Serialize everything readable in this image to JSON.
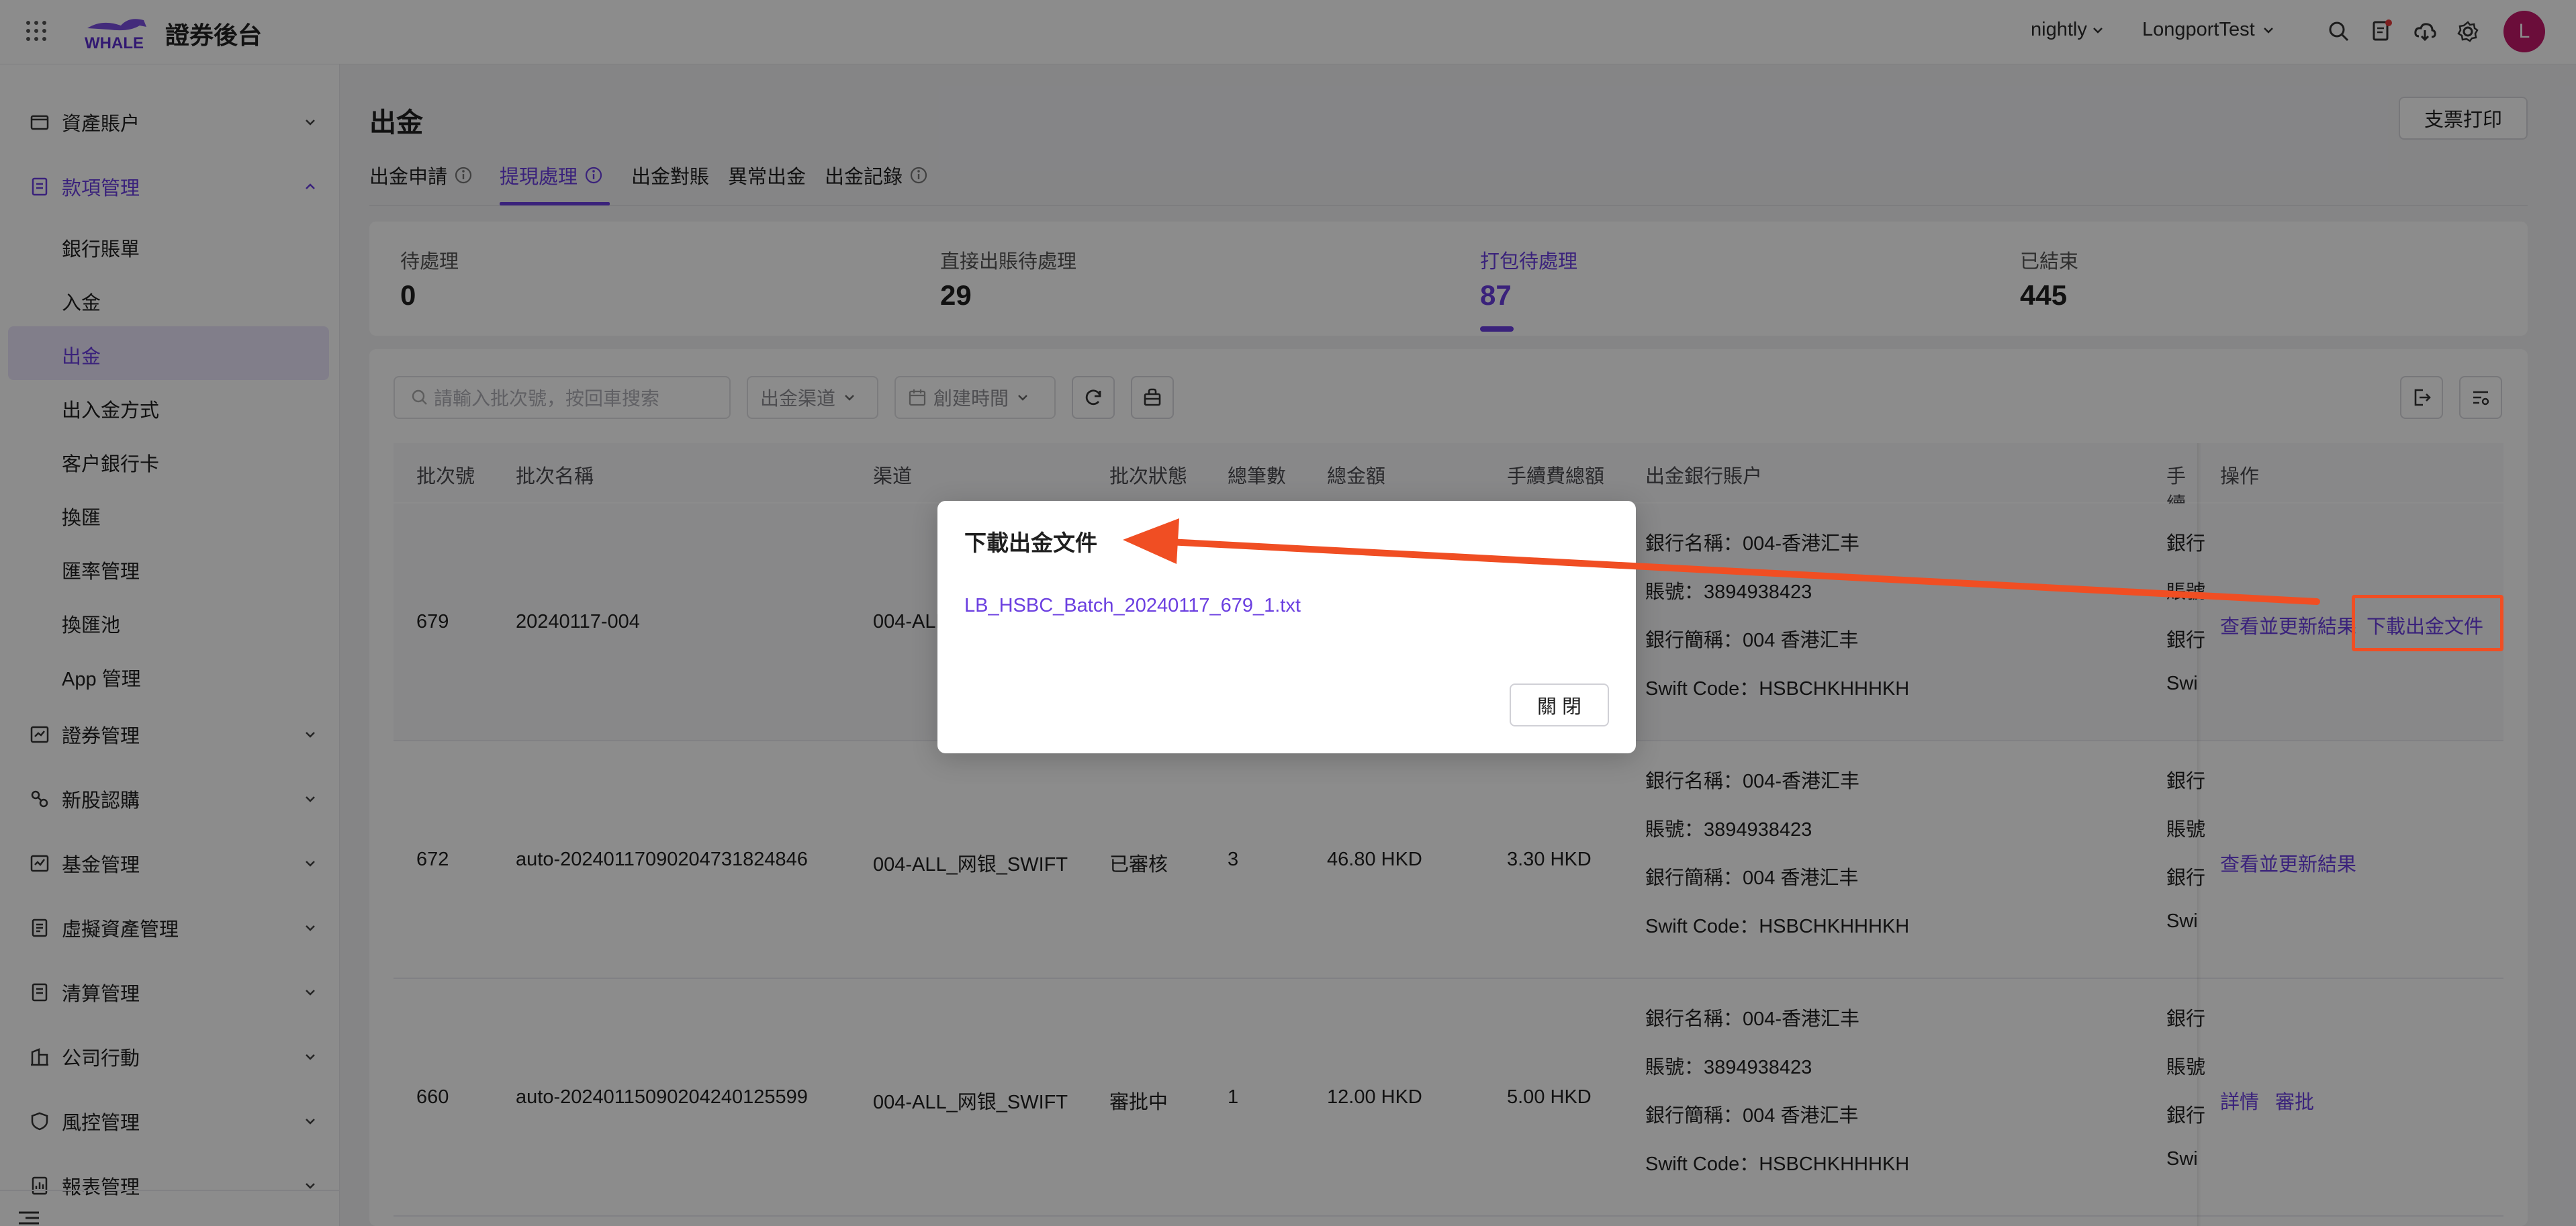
{
  "app": {
    "title": "證券後台"
  },
  "topbar": {
    "env": "nightly",
    "org": "LongportTest",
    "avatar": "L"
  },
  "sidebar": {
    "items": [
      {
        "label": "資產賬户",
        "icon": "folder-icon"
      },
      {
        "label": "款項管理",
        "icon": "document-icon"
      },
      {
        "label": "證券管理",
        "icon": "chart-icon"
      },
      {
        "label": "新股認購",
        "icon": "ipo-icon"
      },
      {
        "label": "基金管理",
        "icon": "fund-icon"
      },
      {
        "label": "虛擬資產管理",
        "icon": "coin-icon"
      },
      {
        "label": "清算管理",
        "icon": "clearing-icon"
      },
      {
        "label": "公司行動",
        "icon": "building-icon"
      },
      {
        "label": "風控管理",
        "icon": "shield-icon"
      },
      {
        "label": "報表管理",
        "icon": "report-icon"
      }
    ],
    "sub_items": [
      "銀行賬單",
      "入金",
      "出金",
      "出入金方式",
      "客户銀行卡",
      "換匯",
      "匯率管理",
      "換匯池",
      "App 管理"
    ]
  },
  "page": {
    "title": "出金",
    "print_button": "支票打印",
    "tabs": [
      "出金申請",
      "提現處理",
      "出金對賬",
      "異常出金",
      "出金記錄"
    ]
  },
  "stats": [
    {
      "label": "待處理",
      "value": "0"
    },
    {
      "label": "直接出賬待處理",
      "value": "29"
    },
    {
      "label": "打包待處理",
      "value": "87"
    },
    {
      "label": "已結束",
      "value": "445"
    }
  ],
  "filters": {
    "search_placeholder": "請輸入批次號，按回車搜索",
    "channel": "出金渠道",
    "created_time": "創建時間"
  },
  "table": {
    "columns": [
      "批次號",
      "批次名稱",
      "渠道",
      "批次狀態",
      "總筆數",
      "總金額",
      "手續費總額",
      "出金銀行賬户",
      "手續",
      "操作"
    ],
    "bank_labels": {
      "name": "銀行名稱：",
      "account": "賬號：",
      "short": "銀行簡稱：",
      "swift": "Swift Code："
    },
    "truncated_labels": {
      "name": "銀行",
      "account": "賬號",
      "short": "銀行",
      "swift": "Swi"
    },
    "rows": [
      {
        "id": "679",
        "name": "20240117-004",
        "channel": "004-ALL",
        "status": "",
        "count": "",
        "amount": "",
        "fee": "",
        "bank_name": "004-香港汇丰",
        "account": "3894938423",
        "short": "004 香港汇丰",
        "swift": "HSBCHKHHHKH",
        "actions": [
          "查看並更新結果",
          "下載出金文件"
        ]
      },
      {
        "id": "672",
        "name": "auto-20240117090204731824846",
        "channel": "004-ALL_网银_SWIFT",
        "status": "已審核",
        "count": "3",
        "amount": "46.80 HKD",
        "fee": "3.30 HKD",
        "bank_name": "004-香港汇丰",
        "account": "3894938423",
        "short": "004 香港汇丰",
        "swift": "HSBCHKHHHKH",
        "actions": [
          "查看並更新結果"
        ]
      },
      {
        "id": "660",
        "name": "auto-20240115090204240125599",
        "channel": "004-ALL_网银_SWIFT",
        "status": "審批中",
        "count": "1",
        "amount": "12.00 HKD",
        "fee": "5.00 HKD",
        "bank_name": "004-香港汇丰",
        "account": "3894938423",
        "short": "004 香港汇丰",
        "swift": "HSBCHKHHHKH",
        "actions": [
          "詳情",
          "審批"
        ]
      }
    ]
  },
  "modal": {
    "title": "下載出金文件",
    "file": "LB_HSBC_Batch_20240117_679_1.txt",
    "close": "關 閉"
  },
  "colors": {
    "accent": "#6b3fe0",
    "annotation": "#f04e23",
    "avatar": "#c4196b"
  }
}
